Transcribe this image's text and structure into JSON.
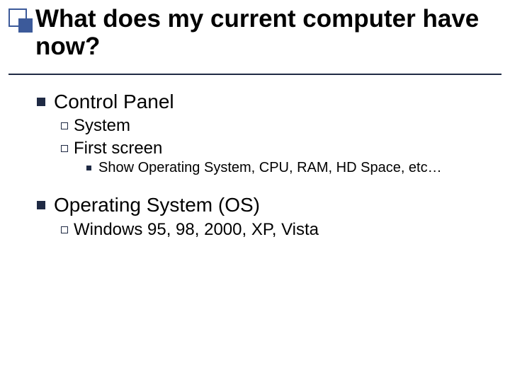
{
  "title": "What does my current computer have now?",
  "items": {
    "i1": "Control Panel",
    "i1a": "System",
    "i1b": "First screen",
    "i1b1": "Show Operating System, CPU, RAM, HD Space, etc…",
    "i2": "Operating System (OS)",
    "i2a": "Windows 95, 98, 2000, XP, Vista"
  }
}
